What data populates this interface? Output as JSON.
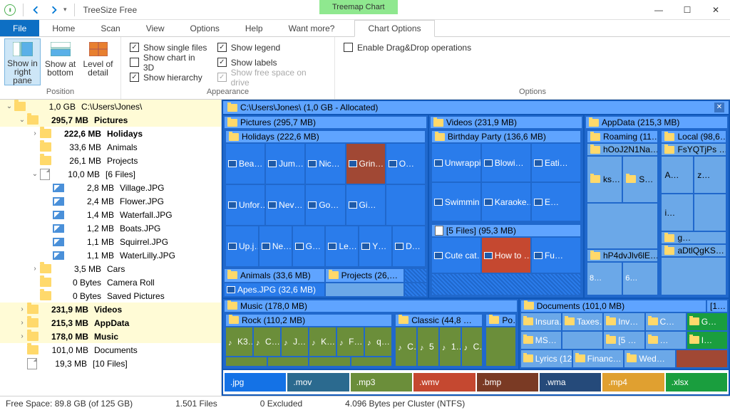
{
  "title": "TreeSize Free",
  "contextTab": "Treemap Chart",
  "menu": {
    "file": "File",
    "home": "Home",
    "scan": "Scan",
    "view": "View",
    "options": "Options",
    "help": "Help",
    "want": "Want more?",
    "chartopts": "Chart Options"
  },
  "ribbon": {
    "showInRight": "Show in right pane",
    "showAtBottom": "Show at bottom",
    "levelDetail": "Level of detail",
    "singleFiles": "Show single files",
    "chart3d": "Show chart in 3D",
    "hierarchy": "Show hierarchy",
    "legend": "Show legend",
    "labels": "Show labels",
    "freeSpace": "Show free space on drive",
    "dragDrop": "Enable Drag&Drop operations",
    "grpPosition": "Position",
    "grpAppearance": "Appearance",
    "grpOptions": "Options"
  },
  "tree": [
    {
      "d": 0,
      "exp": "v",
      "ic": "folder",
      "size": "1,0 GB",
      "name": "C:\\Users\\Jones\\",
      "root": true
    },
    {
      "d": 1,
      "exp": "v",
      "ic": "folder",
      "size": "295,7 MB",
      "name": "Pictures",
      "root": true,
      "bold": true
    },
    {
      "d": 2,
      "exp": ">",
      "ic": "folder",
      "size": "222,6 MB",
      "name": "Holidays",
      "bold": true
    },
    {
      "d": 2,
      "exp": "",
      "ic": "folder",
      "size": "33,6 MB",
      "name": "Animals"
    },
    {
      "d": 2,
      "exp": "",
      "ic": "folder",
      "size": "26,1 MB",
      "name": "Projects"
    },
    {
      "d": 2,
      "exp": "v",
      "ic": "file",
      "size": "10,0 MB",
      "name": "[6 Files]"
    },
    {
      "d": 3,
      "exp": "",
      "ic": "jpg",
      "size": "2,8 MB",
      "name": "Village.JPG"
    },
    {
      "d": 3,
      "exp": "",
      "ic": "jpg",
      "size": "2,4 MB",
      "name": "Flower.JPG"
    },
    {
      "d": 3,
      "exp": "",
      "ic": "jpg",
      "size": "1,4 MB",
      "name": "Waterfall.JPG"
    },
    {
      "d": 3,
      "exp": "",
      "ic": "jpg",
      "size": "1,2 MB",
      "name": "Boats.JPG"
    },
    {
      "d": 3,
      "exp": "",
      "ic": "jpg",
      "size": "1,1 MB",
      "name": "Squirrel.JPG"
    },
    {
      "d": 3,
      "exp": "",
      "ic": "jpg",
      "size": "1,1 MB",
      "name": "WaterLilly.JPG"
    },
    {
      "d": 2,
      "exp": ">",
      "ic": "folder",
      "size": "3,5 MB",
      "name": "Cars"
    },
    {
      "d": 2,
      "exp": "",
      "ic": "folder",
      "size": "0 Bytes",
      "name": "Camera Roll"
    },
    {
      "d": 2,
      "exp": "",
      "ic": "folder",
      "size": "0 Bytes",
      "name": "Saved Pictures"
    },
    {
      "d": 1,
      "exp": ">",
      "ic": "folder",
      "size": "231,9 MB",
      "name": "Videos",
      "root": true,
      "bold": true
    },
    {
      "d": 1,
      "exp": ">",
      "ic": "folder",
      "size": "215,3 MB",
      "name": "AppData",
      "root": true,
      "bold": true
    },
    {
      "d": 1,
      "exp": ">",
      "ic": "folder",
      "size": "178,0 MB",
      "name": "Music",
      "root": true,
      "bold": true
    },
    {
      "d": 1,
      "exp": "",
      "ic": "folder",
      "size": "101,0 MB",
      "name": "Documents"
    },
    {
      "d": 1,
      "exp": "",
      "ic": "file",
      "size": "19,3 MB",
      "name": "[10 Files]"
    }
  ],
  "chartTitle": "C:\\Users\\Jones\\ (1,0 GB - Allocated)",
  "tm": {
    "pictures": "Pictures (295,7 MB)",
    "holidays": "Holidays (222,6 MB)",
    "hr1": [
      "Bea…",
      "Jum…",
      "Nic…",
      "Grin…",
      "O…"
    ],
    "hr2": [
      "Unfor…",
      "Nev…",
      "Go…",
      "Gi…",
      ""
    ],
    "hr3": [
      "Up.j…",
      "Ne…",
      "G…",
      "Le…",
      "Y…",
      "D…"
    ],
    "animals": "Animals (33,6 MB)",
    "projects": "Projects (26,…",
    "apes": "Apes.JPG (32,6 MB)",
    "videos": "Videos (231,9 MB)",
    "bparty": "Birthday Party (136,6 MB)",
    "vr1": [
      "Unwrappi…",
      "Blowi…",
      "Eati…"
    ],
    "vr2": [
      "Swimmin…",
      "Karaoke.…",
      "E…"
    ],
    "files5": "[5 Files] (95,3 MB)",
    "fr": [
      "Cute cat…",
      "How to …",
      "Fu…"
    ],
    "appdata": "AppData (215,3 MB)",
    "roaming": "Roaming (11…",
    "local": "Local (98,6…",
    "hooj": "hOoJ2N1Na…",
    "fsy": "FsYQTjPs …",
    "ks": "ks…",
    "ss": "S…",
    "az": "A…",
    "zz": "z…",
    "ii": "i…",
    "gg": "g…",
    "hp4": "hP4dvJlv6lE…",
    "adt": "aDtlQgKS…",
    "music": "Music (178,0 MB)",
    "rock": "Rock (110,2 MB)",
    "classic": "Classic (44,8 …",
    "po": "Po…",
    "mr": [
      "K3…",
      "C…",
      "J…",
      "K…",
      "F…",
      "q…"
    ],
    "cr": [
      "C…",
      "5",
      "1…",
      "C…"
    ],
    "docs": "Documents (101,0 MB)",
    "files1": "[1…",
    "dr1": [
      "Insura…",
      "Taxes…",
      "Inv…",
      "C…",
      "G…"
    ],
    "dr2": [
      "MS…",
      "",
      "[5 …",
      "…",
      "I…"
    ],
    "dr3": [
      "Lyrics (12,…",
      "Financ…",
      "Wed…",
      ""
    ]
  },
  "legend": [
    {
      "ext": ".jpg",
      "c": "#1472e6"
    },
    {
      "ext": ".mov",
      "c": "#2b6a8f"
    },
    {
      "ext": ".mp3",
      "c": "#6b8e3a"
    },
    {
      "ext": ".wmv",
      "c": "#c54830"
    },
    {
      "ext": ".bmp",
      "c": "#7a3a24"
    },
    {
      "ext": ".wma",
      "c": "#254a7a"
    },
    {
      "ext": ".mp4",
      "c": "#e0a030"
    },
    {
      "ext": ".xlsx",
      "c": "#1a9e3e"
    }
  ],
  "status": {
    "free": "Free Space: 89.8 GB  (of 125 GB)",
    "files": "1.501 Files",
    "excl": "0 Excluded",
    "cluster": "4.096 Bytes per Cluster (NTFS)"
  }
}
